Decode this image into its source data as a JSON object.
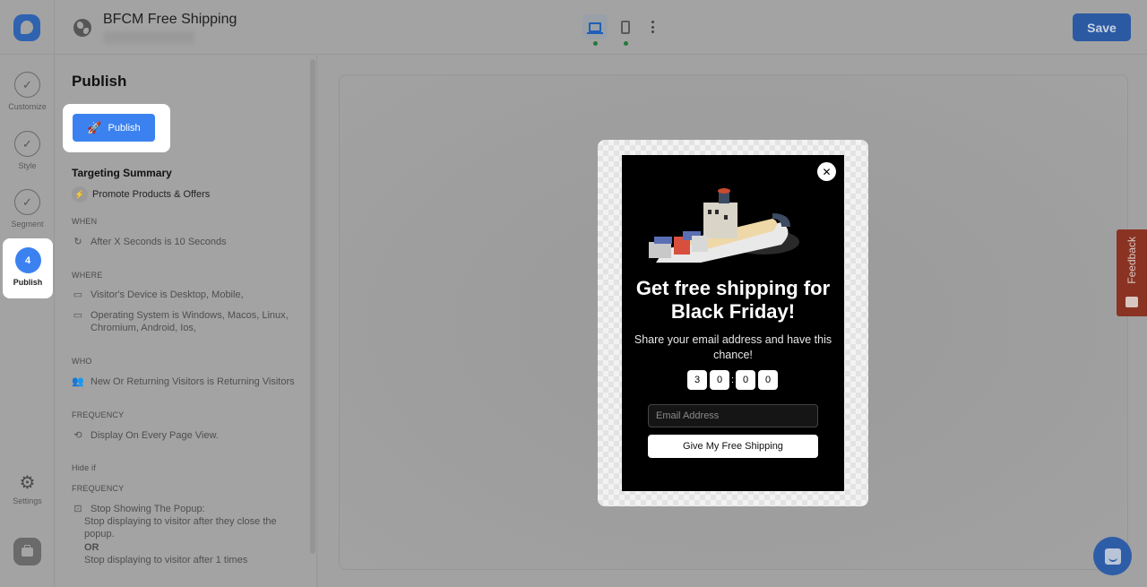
{
  "header": {
    "title": "BFCM Free Shipping",
    "save_label": "Save",
    "devices": [
      {
        "name": "desktop",
        "active": true
      },
      {
        "name": "mobile",
        "active": false
      }
    ]
  },
  "rail": {
    "steps": [
      {
        "label": "Customize",
        "state": "done"
      },
      {
        "label": "Style",
        "state": "done"
      },
      {
        "label": "Segment",
        "state": "done"
      },
      {
        "label": "Publish",
        "number": "4",
        "state": "active"
      }
    ],
    "settings_label": "Settings"
  },
  "panel": {
    "title": "Publish",
    "publish_button": "Publish",
    "targeting_title": "Targeting Summary",
    "goal": "Promote Products & Offers",
    "when_label": "WHEN",
    "when_value": "After X Seconds is 10 Seconds",
    "where_label": "WHERE",
    "where_device": "Visitor's Device is Desktop, Mobile,",
    "where_os": "Operating System is Windows, Macos, Linux, Chromium, Android, Ios,",
    "who_label": "WHO",
    "who_value": "New Or Returning Visitors is Returning Visitors",
    "frequency_label": "FREQUENCY",
    "frequency_value": "Display On Every Page View.",
    "hide_if_label": "Hide if",
    "hide_frequency_label": "FREQUENCY",
    "stop_title": "Stop Showing The Popup:",
    "stop_close": "Stop displaying to visitor after they close the popup.",
    "or_label": "OR",
    "stop_times": "Stop displaying to visitor after 1 times"
  },
  "popup": {
    "headline": "Get free shipping for Black Friday!",
    "subtext": "Share your email address and have this chance!",
    "timer": [
      "3",
      "0",
      "0",
      "0"
    ],
    "email_placeholder": "Email Address",
    "cta_label": "Give My Free Shipping"
  },
  "widgets": {
    "feedback_label": "Feedback"
  },
  "colors": {
    "primary": "#3b82f0",
    "save": "#2b5aa3",
    "feedback": "#8a3323",
    "or_link": "#1f55a8"
  }
}
